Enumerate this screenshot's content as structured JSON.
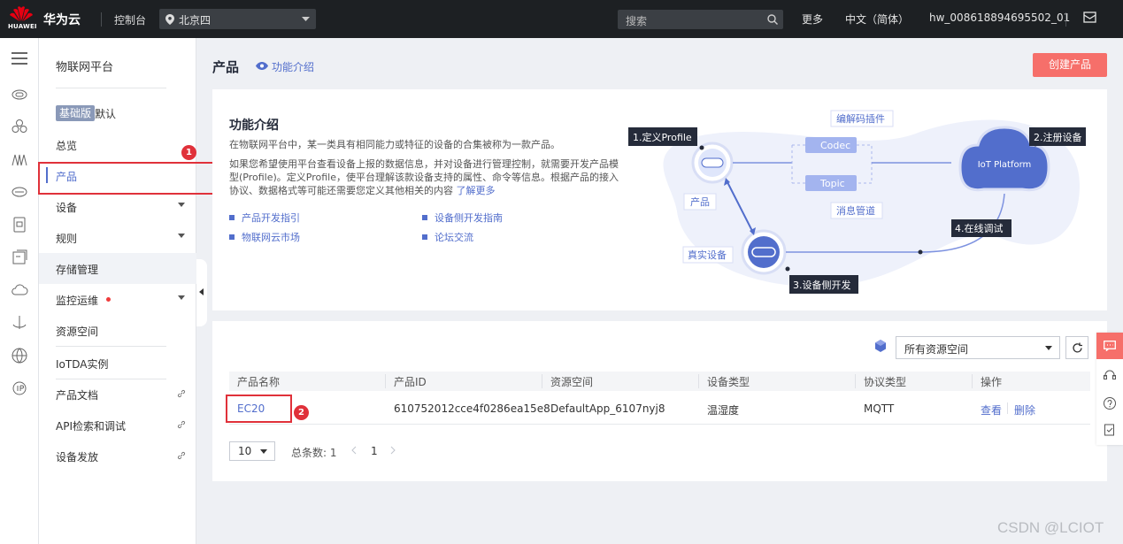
{
  "topbar": {
    "logo_text": "HUAWEI",
    "brand": "华为云",
    "console": "控制台",
    "region": "北京四",
    "search_placeholder": "搜索",
    "more": "更多",
    "language": "中文（简体）",
    "username": "hw_008618894695502_01",
    "icons": [
      "huawei-logo",
      "location-pin-icon",
      "chevron-down-icon",
      "search-icon",
      "mail-icon"
    ]
  },
  "icon_rail": {
    "items": [
      "menu-icon",
      "cloud-service-icon",
      "cluster-icon",
      "network-icon",
      "storage-icon",
      "database-icon",
      "server-icon",
      "cloud-icon",
      "antenna-icon",
      "globe-icon",
      "ip-icon"
    ]
  },
  "sidebar": {
    "title": "物联网平台",
    "edition_badge": "基础版",
    "edition_default": "默认",
    "items": [
      {
        "label": "总览"
      },
      {
        "label": "产品"
      },
      {
        "label": "设备"
      },
      {
        "label": "规则"
      },
      {
        "label": "存储管理"
      },
      {
        "label": "监控运维"
      },
      {
        "label": "资源空间"
      },
      {
        "label": "IoTDA实例"
      },
      {
        "label": "产品文档"
      },
      {
        "label": "API检索和调试"
      },
      {
        "label": "设备发放"
      }
    ]
  },
  "annotations": [
    "1",
    "2"
  ],
  "page": {
    "title": "产品",
    "func_intro_link": "功能介绍",
    "create_button": "创建产品"
  },
  "intro": {
    "title": "功能介绍",
    "para1": "在物联网平台中，某一类具有相同能力或特征的设备的合集被称为一款产品。",
    "para2": "如果您希望使用平台查看设备上报的数据信息，并对设备进行管理控制，就需要开发产品模型(Profile)。定义Profile，使平台理解该款设备支持的属性、命令等信息。根据产品的接入协议、数据格式等可能还需要您定义其他相关的内容",
    "learn_more": "了解更多",
    "links": [
      "产品开发指引",
      "设备侧开发指南",
      "物联网云市场",
      "论坛交流"
    ],
    "diagram": {
      "step1": "1.定义Profile",
      "step2": "2.注册设备",
      "step3": "3.设备侧开发",
      "step4": "4.在线调试",
      "codec_plugin": "编解码插件",
      "codec": "Codec",
      "topic": "Topic",
      "message_pipe": "消息管道",
      "product": "产品",
      "real_device": "真实设备",
      "iot_platform": "IoT Platform"
    }
  },
  "table": {
    "resource_space_select": "所有资源空间",
    "columns": [
      "产品名称",
      "产品ID",
      "资源空间",
      "设备类型",
      "协议类型",
      "操作"
    ],
    "rows": [
      {
        "name": "EC20",
        "id": "610752012cce4f0286ea15e8",
        "space": "DefaultApp_6107nyj8",
        "device_type": "温湿度",
        "protocol": "MQTT",
        "view": "查看",
        "delete": "删除"
      }
    ],
    "page_size": "10",
    "total": "总条数: 1",
    "current_page": "1"
  },
  "watermark": "CSDN @LCIOT",
  "colors": {
    "accent": "#526ecc",
    "primary_button": "#f66f6a",
    "annotation": "#e0313a",
    "topbar": "#1d2023"
  }
}
